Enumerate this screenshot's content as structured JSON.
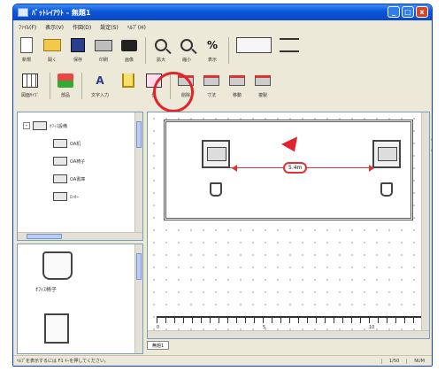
{
  "window": {
    "title": "ﾊﾟｯﾄﾚｲｱｳﾄ - 無題1",
    "controls": [
      "_",
      "□",
      "x"
    ]
  },
  "menu": [
    "ﾌｧｲﾙ(F)",
    "表示(V)",
    "作図(D)",
    "設定(S)",
    "ﾍﾙﾌﾟ(H)"
  ],
  "toolbar1": [
    {
      "label": "新規",
      "icon": "new-doc-icon"
    },
    {
      "label": "開く",
      "icon": "open-folder-icon"
    },
    {
      "label": "保存",
      "icon": "save-disk-icon"
    },
    {
      "label": "印刷",
      "icon": "print-icon"
    },
    {
      "label": "画像",
      "icon": "camera-icon"
    },
    {
      "label": "拡大",
      "icon": "zoom-in-icon"
    },
    {
      "label": "縮小",
      "icon": "zoom-out-icon"
    },
    {
      "label": "表示",
      "icon": "ratio-icon"
    }
  ],
  "toolbar2": [
    {
      "label": "図面ｻｲｽﾞ",
      "icon": "grid-icon"
    },
    {
      "label": "部品",
      "icon": "parts-icon"
    },
    {
      "label": "文字入力",
      "icon": "text-icon"
    },
    {
      "label": "",
      "icon": "chair-tool-icon"
    },
    {
      "label": "壁",
      "icon": "wall-icon"
    },
    {
      "label": "削除",
      "icon": "delete-icon"
    },
    {
      "label": "寸法",
      "icon": "dimension-icon"
    },
    {
      "label": "移動",
      "icon": "move-icon"
    },
    {
      "label": "複製",
      "icon": "copy-icon"
    }
  ],
  "tree": {
    "root": "ｵﾌｨｽ設備",
    "children": [
      "OA机",
      "OA椅子",
      "OA書庫",
      "ﾛｯｶｰ"
    ]
  },
  "palette": {
    "item1": "ｵﾌｨｽ椅子"
  },
  "canvas": {
    "dimension": "5.4m",
    "ruler_labels": [
      "0",
      "5",
      "10"
    ]
  },
  "tabs": [
    "無題1"
  ],
  "status": {
    "help": "ﾍﾙﾌﾟを表示するには F1 ｷｰを押してください。",
    "scale": "1/50",
    "mode": "NUM"
  }
}
